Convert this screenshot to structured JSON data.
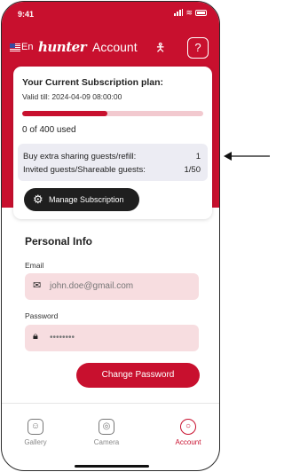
{
  "status": {
    "time": "9:41"
  },
  "header": {
    "lang": "En",
    "brand": "hunter",
    "title": "Account",
    "help": "?"
  },
  "subscription": {
    "plan_label": "Your Current Subscription plan:",
    "valid_till": "Valid till:  2024-04-09 08:00:00",
    "used_fraction": 0.47,
    "used_text": "0 of 400 used",
    "extra_label": "Buy extra sharing guests/refill:",
    "extra_value": "1",
    "invited_label": "Invited guests/Shareable guests:",
    "invited_value": "1/50",
    "manage_label": "Manage Subscription"
  },
  "personal": {
    "title": "Personal Info",
    "email_label": "Email",
    "email_value": "john.doe@gmail.com",
    "password_label": "Password",
    "password_value": "••••••••",
    "change_password": "Change Password"
  },
  "tabs": [
    {
      "label": "Gallery",
      "icon": "gallery-icon"
    },
    {
      "label": "Camera",
      "icon": "camera-icon"
    },
    {
      "label": "Account",
      "icon": "account-icon"
    }
  ],
  "colors": {
    "brand": "#c8102e",
    "dark": "#1f1f1f"
  }
}
